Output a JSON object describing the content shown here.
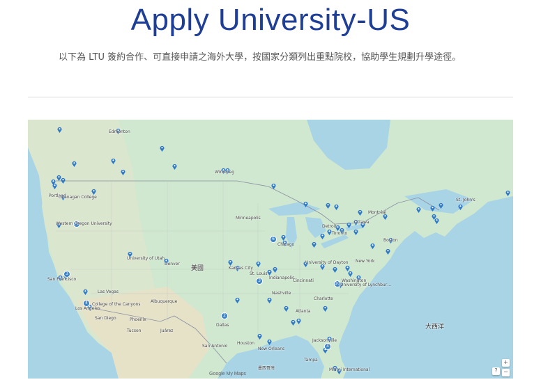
{
  "page": {
    "title": "Apply University-US",
    "intro": "以下為 LTU 簽約合作、可直接申請之海外大學，按國家分類列出重點院校，協助學生規劃升學途徑。"
  },
  "map": {
    "attribution": "Google My Maps",
    "colors": {
      "water": "#a8d4e6",
      "land": "#cfe8cf",
      "pin": "#2e78c4"
    },
    "controls": {
      "help": "?",
      "zoom_in": "+",
      "zoom_out": "−"
    },
    "labels": {
      "usa": "美國",
      "atlantic": "大西洋",
      "gulf": "墨西哥灣",
      "edmonton": "Edmonton",
      "winnipeg": "Winnipeg",
      "minneapolis": "Minneapolis",
      "chicago": "Chicago",
      "detroit": "Detroit",
      "montreal": "Montréal",
      "ottawa": "Ottawa",
      "toronto": "Toronto",
      "boston": "Boston",
      "new_york": "New York",
      "washington": "Washington",
      "denver": "Denver",
      "salt_lake": "University of Utah",
      "las_vegas": "Las Vegas",
      "los_angeles": "Los Angeles",
      "san_diego": "San Diego",
      "phoenix": "Phoenix",
      "albuquerque": "Albuquerque",
      "dallas": "Dallas",
      "houston": "Houston",
      "san_antonio": "San Antonio",
      "kansas_city": "Kansas City",
      "st_louis": "St. Louis",
      "indianapolis": "Indianapolis",
      "cincinnati": "Cincinnati",
      "nashville": "Nashville",
      "atlanta": "Atlanta",
      "charlotte": "Charlotte",
      "jacksonville": "Jacksonville",
      "tampa": "Tampa",
      "miami": "Miami International",
      "new_orleans": "New Orleans",
      "portland": "Portland",
      "oregon": "Western Oregon University",
      "dayton": "University of Dayton",
      "lynchburg": "University of Lynchbur…",
      "kelowna": "Okanagan College",
      "college_canyons": "College of the Canyons",
      "tucson": "Tucson",
      "juarez": "Juárez",
      "san_fran": "San Francisco",
      "st_johns": "St. John's"
    }
  }
}
